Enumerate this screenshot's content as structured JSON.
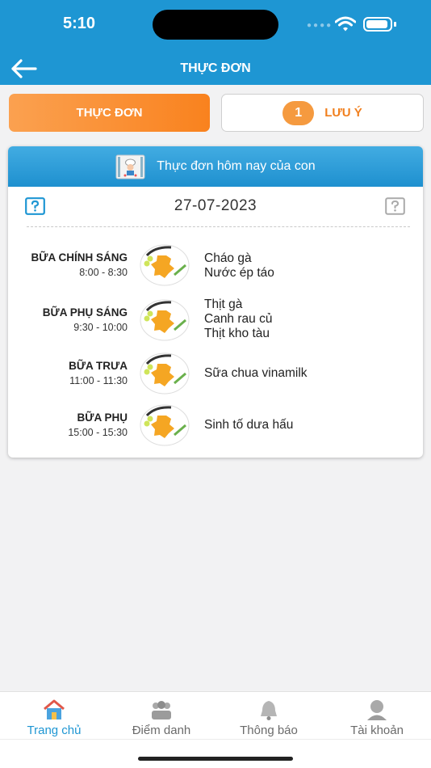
{
  "status_bar": {
    "time": "5:10"
  },
  "header": {
    "title": "THỰC ĐƠN"
  },
  "tabs": {
    "menu_label": "THỰC ĐƠN",
    "notes_label": "LƯU Ý",
    "notes_count": "1"
  },
  "card": {
    "heading": "Thực đơn hôm nay của con",
    "date": "27-07-2023",
    "meals": [
      {
        "name": "BỮA CHÍNH SÁNG",
        "time": "8:00 - 8:30",
        "dishes": [
          "Cháo gà",
          "Nước ép táo"
        ]
      },
      {
        "name": "BỮA PHỤ SÁNG",
        "time": "9:30 - 10:00",
        "dishes": [
          "Thịt gà",
          "Canh rau củ",
          "Thịt kho tàu"
        ]
      },
      {
        "name": "BỮA TRƯA",
        "time": "11:00 - 11:30",
        "dishes": [
          "Sữa chua vinamilk"
        ]
      },
      {
        "name": "BỮA PHỤ",
        "time": "15:00 - 15:30",
        "dishes": [
          "Sinh tố dưa hấu"
        ]
      }
    ]
  },
  "bottom_nav": [
    {
      "label": "Trang chủ",
      "icon": "home-icon",
      "active": true
    },
    {
      "label": "Điểm danh",
      "icon": "attendance-icon",
      "active": false
    },
    {
      "label": "Thông báo",
      "icon": "bell-icon",
      "active": false
    },
    {
      "label": "Tài khoản",
      "icon": "account-icon",
      "active": false
    }
  ],
  "colors": {
    "primary": "#1e96d3",
    "accent": "#f9821e",
    "background": "#f2f2f3"
  }
}
